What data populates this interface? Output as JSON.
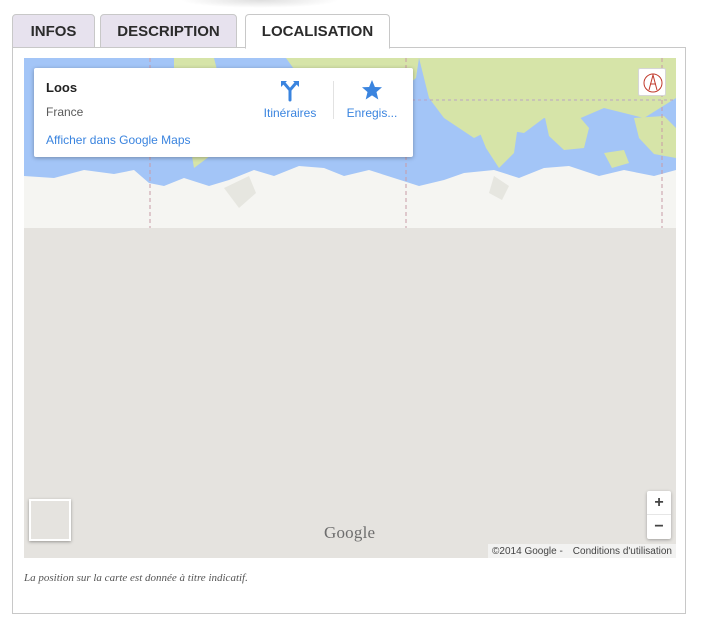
{
  "tabs": [
    {
      "label": "INFOS",
      "active": false
    },
    {
      "label": "DESCRIPTION",
      "active": false
    },
    {
      "label": "LOCALISATION",
      "active": true
    }
  ],
  "map": {
    "info_card": {
      "place_name": "Loos",
      "country": "France",
      "maps_link": "Afficher dans Google Maps",
      "routes_label": "Itinéraires",
      "save_label": "Enregis..."
    },
    "logo_text": "Google",
    "copyright": "©2014 Google -",
    "terms": "Conditions d'utilisation",
    "controls": {
      "zoom_in": "+",
      "zoom_out": "−"
    }
  },
  "note": "La position sur la carte est donnée à titre indicatif.",
  "colors": {
    "ocean": "#a3c5f7",
    "land": "#d6e4a8",
    "ice": "#f5f5f2",
    "map_background": "#e5e3df",
    "link": "#3a84df",
    "tab_inactive": "#e7e2ee"
  },
  "icons": [
    "routes-icon",
    "star-icon",
    "compass-icon"
  ]
}
